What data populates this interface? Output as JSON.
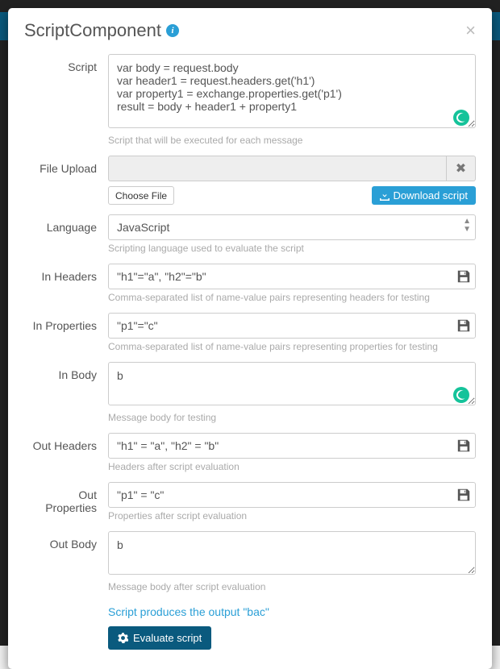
{
  "modal": {
    "title": "ScriptComponent"
  },
  "labels": {
    "script": "Script",
    "fileUpload": "File Upload",
    "language": "Language",
    "inHeaders": "In Headers",
    "inProperties": "In Properties",
    "inBody": "In Body",
    "outHeaders": "Out Headers",
    "outProperties": "Out Properties",
    "outBody": "Out Body"
  },
  "help": {
    "script": "Script that will be executed for each message",
    "language": "Scripting language used to evaluate the script",
    "inHeaders": "Comma-separated list of name-value pairs representing headers for testing",
    "inProperties": "Comma-separated list of name-value pairs representing properties for testing",
    "inBody": "Message body for testing",
    "outHeaders": "Headers after script evaluation",
    "outProperties": "Properties after script evaluation",
    "outBody": "Message body after script evaluation"
  },
  "values": {
    "script": "var body = request.body\nvar header1 = request.headers.get('h1')\nvar property1 = exchange.properties.get('p1')\nresult = body + header1 + property1",
    "language": "JavaScript",
    "inHeaders": "\"h1\"=\"a\", \"h2\"=\"b\"",
    "inProperties": "\"p1\"=\"c\"",
    "inBody": "b",
    "outHeaders": "\"h1\" = \"a\", \"h2\" = \"b\"",
    "outProperties": "\"p1\" = \"c\"",
    "outBody": "b"
  },
  "buttons": {
    "chooseFile": "Choose File",
    "download": "Download script",
    "evaluate": "Evaluate script"
  },
  "output": {
    "message": "Script produces the output \"bac\""
  }
}
